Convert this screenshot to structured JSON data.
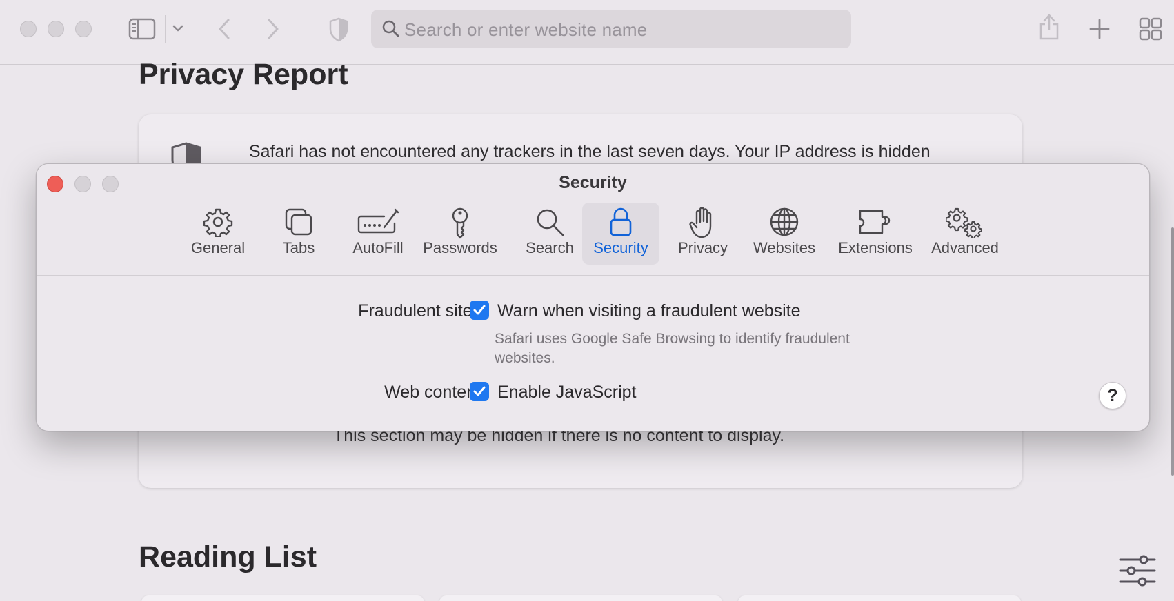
{
  "toolbar": {
    "search_placeholder": "Search or enter website name",
    "icons": [
      "sidebar-icon",
      "chevron-down-icon",
      "back-icon",
      "forward-icon",
      "shield-icon",
      "share-icon",
      "plus-icon",
      "tab-overview-icon"
    ]
  },
  "page": {
    "privacy_report_heading": "Privacy Report",
    "privacy_card_text": "Safari has not encountered any trackers in the last seven days. Your IP address is hidden",
    "privacy_card_note": "This section may be hidden if there is no content to display.",
    "reading_list_heading": "Reading List"
  },
  "prefs": {
    "title": "Security",
    "tabs": [
      {
        "label": "General",
        "icon": "gear-icon"
      },
      {
        "label": "Tabs",
        "icon": "tabs-icon"
      },
      {
        "label": "AutoFill",
        "icon": "autofill-icon"
      },
      {
        "label": "Passwords",
        "icon": "key-icon"
      },
      {
        "label": "Search",
        "icon": "search-icon"
      },
      {
        "label": "Security",
        "icon": "lock-icon",
        "active": true
      },
      {
        "label": "Privacy",
        "icon": "hand-icon"
      },
      {
        "label": "Websites",
        "icon": "globe-icon"
      },
      {
        "label": "Extensions",
        "icon": "puzzle-icon"
      },
      {
        "label": "Advanced",
        "icon": "gears-icon"
      }
    ],
    "fraudulent": {
      "label": "Fraudulent sites:",
      "option": "Warn when visiting a fraudulent website",
      "checked": true,
      "hint": "Safari uses Google Safe Browsing to identify fraudulent websites."
    },
    "web_content": {
      "label": "Web content:",
      "option": "Enable JavaScript",
      "checked": true
    },
    "help_label": "?"
  },
  "colors": {
    "accent": "#1f78f0",
    "active_tab_text": "#1263d8",
    "close_dot": "#ee5e57"
  }
}
